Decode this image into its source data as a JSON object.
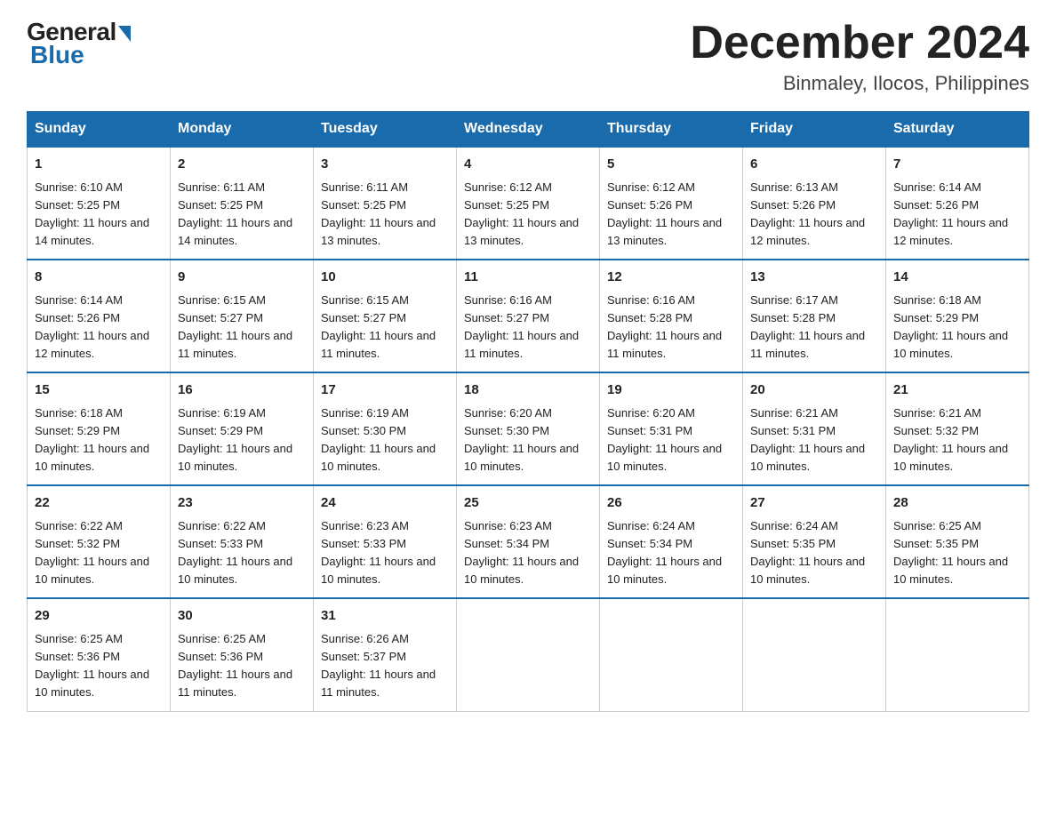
{
  "logo": {
    "general": "General",
    "blue": "Blue"
  },
  "header": {
    "month": "December 2024",
    "location": "Binmaley, Ilocos, Philippines"
  },
  "days_of_week": [
    "Sunday",
    "Monday",
    "Tuesday",
    "Wednesday",
    "Thursday",
    "Friday",
    "Saturday"
  ],
  "weeks": [
    [
      {
        "day": "1",
        "sunrise": "6:10 AM",
        "sunset": "5:25 PM",
        "daylight": "11 hours and 14 minutes."
      },
      {
        "day": "2",
        "sunrise": "6:11 AM",
        "sunset": "5:25 PM",
        "daylight": "11 hours and 14 minutes."
      },
      {
        "day": "3",
        "sunrise": "6:11 AM",
        "sunset": "5:25 PM",
        "daylight": "11 hours and 13 minutes."
      },
      {
        "day": "4",
        "sunrise": "6:12 AM",
        "sunset": "5:25 PM",
        "daylight": "11 hours and 13 minutes."
      },
      {
        "day": "5",
        "sunrise": "6:12 AM",
        "sunset": "5:26 PM",
        "daylight": "11 hours and 13 minutes."
      },
      {
        "day": "6",
        "sunrise": "6:13 AM",
        "sunset": "5:26 PM",
        "daylight": "11 hours and 12 minutes."
      },
      {
        "day": "7",
        "sunrise": "6:14 AM",
        "sunset": "5:26 PM",
        "daylight": "11 hours and 12 minutes."
      }
    ],
    [
      {
        "day": "8",
        "sunrise": "6:14 AM",
        "sunset": "5:26 PM",
        "daylight": "11 hours and 12 minutes."
      },
      {
        "day": "9",
        "sunrise": "6:15 AM",
        "sunset": "5:27 PM",
        "daylight": "11 hours and 11 minutes."
      },
      {
        "day": "10",
        "sunrise": "6:15 AM",
        "sunset": "5:27 PM",
        "daylight": "11 hours and 11 minutes."
      },
      {
        "day": "11",
        "sunrise": "6:16 AM",
        "sunset": "5:27 PM",
        "daylight": "11 hours and 11 minutes."
      },
      {
        "day": "12",
        "sunrise": "6:16 AM",
        "sunset": "5:28 PM",
        "daylight": "11 hours and 11 minutes."
      },
      {
        "day": "13",
        "sunrise": "6:17 AM",
        "sunset": "5:28 PM",
        "daylight": "11 hours and 11 minutes."
      },
      {
        "day": "14",
        "sunrise": "6:18 AM",
        "sunset": "5:29 PM",
        "daylight": "11 hours and 10 minutes."
      }
    ],
    [
      {
        "day": "15",
        "sunrise": "6:18 AM",
        "sunset": "5:29 PM",
        "daylight": "11 hours and 10 minutes."
      },
      {
        "day": "16",
        "sunrise": "6:19 AM",
        "sunset": "5:29 PM",
        "daylight": "11 hours and 10 minutes."
      },
      {
        "day": "17",
        "sunrise": "6:19 AM",
        "sunset": "5:30 PM",
        "daylight": "11 hours and 10 minutes."
      },
      {
        "day": "18",
        "sunrise": "6:20 AM",
        "sunset": "5:30 PM",
        "daylight": "11 hours and 10 minutes."
      },
      {
        "day": "19",
        "sunrise": "6:20 AM",
        "sunset": "5:31 PM",
        "daylight": "11 hours and 10 minutes."
      },
      {
        "day": "20",
        "sunrise": "6:21 AM",
        "sunset": "5:31 PM",
        "daylight": "11 hours and 10 minutes."
      },
      {
        "day": "21",
        "sunrise": "6:21 AM",
        "sunset": "5:32 PM",
        "daylight": "11 hours and 10 minutes."
      }
    ],
    [
      {
        "day": "22",
        "sunrise": "6:22 AM",
        "sunset": "5:32 PM",
        "daylight": "11 hours and 10 minutes."
      },
      {
        "day": "23",
        "sunrise": "6:22 AM",
        "sunset": "5:33 PM",
        "daylight": "11 hours and 10 minutes."
      },
      {
        "day": "24",
        "sunrise": "6:23 AM",
        "sunset": "5:33 PM",
        "daylight": "11 hours and 10 minutes."
      },
      {
        "day": "25",
        "sunrise": "6:23 AM",
        "sunset": "5:34 PM",
        "daylight": "11 hours and 10 minutes."
      },
      {
        "day": "26",
        "sunrise": "6:24 AM",
        "sunset": "5:34 PM",
        "daylight": "11 hours and 10 minutes."
      },
      {
        "day": "27",
        "sunrise": "6:24 AM",
        "sunset": "5:35 PM",
        "daylight": "11 hours and 10 minutes."
      },
      {
        "day": "28",
        "sunrise": "6:25 AM",
        "sunset": "5:35 PM",
        "daylight": "11 hours and 10 minutes."
      }
    ],
    [
      {
        "day": "29",
        "sunrise": "6:25 AM",
        "sunset": "5:36 PM",
        "daylight": "11 hours and 10 minutes."
      },
      {
        "day": "30",
        "sunrise": "6:25 AM",
        "sunset": "5:36 PM",
        "daylight": "11 hours and 11 minutes."
      },
      {
        "day": "31",
        "sunrise": "6:26 AM",
        "sunset": "5:37 PM",
        "daylight": "11 hours and 11 minutes."
      },
      null,
      null,
      null,
      null
    ]
  ]
}
